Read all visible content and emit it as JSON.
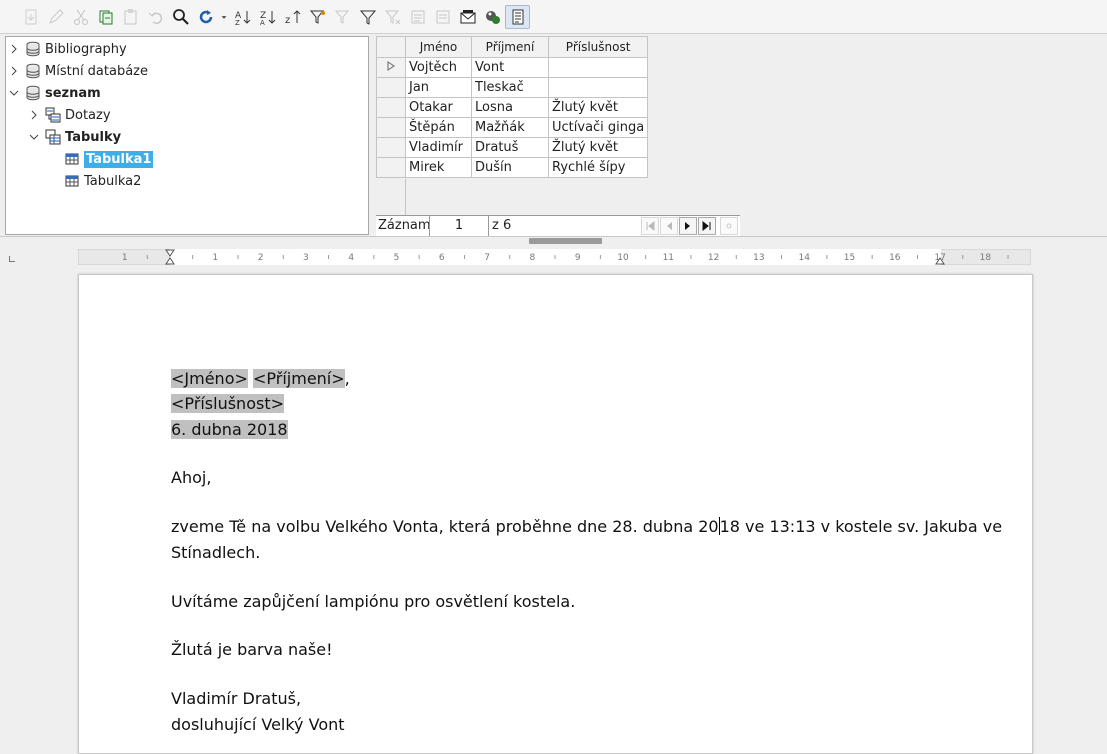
{
  "toolbar": {
    "buttons": [
      "save-record-icon",
      "edit-icon",
      "cut-icon",
      "copy-icon",
      "paste-icon",
      "undo-icon",
      "search-icon",
      "refresh-icon",
      "sort-ascending-icon",
      "sort-descending-icon",
      "sort-icon",
      "autofilter-icon",
      "standard-filter-icon",
      "filter-icon",
      "remove-filter-icon",
      "data-to-text-icon",
      "data-to-fields-icon",
      "mail-merge-icon",
      "data-source-icon",
      "explorer-icon"
    ]
  },
  "tree": {
    "items": [
      {
        "label": "Bibliography",
        "level": 0,
        "expanded": false,
        "kind": "db"
      },
      {
        "label": "Místní databáze",
        "level": 0,
        "expanded": false,
        "kind": "db"
      },
      {
        "label": "seznam",
        "level": 0,
        "expanded": true,
        "kind": "db",
        "bold": true
      },
      {
        "label": "Dotazy",
        "level": 1,
        "expanded": false,
        "kind": "queries"
      },
      {
        "label": "Tabulky",
        "level": 1,
        "expanded": true,
        "kind": "tables",
        "bold": true
      },
      {
        "label": "Tabulka1",
        "level": 2,
        "kind": "table",
        "selected": true
      },
      {
        "label": "Tabulka2",
        "level": 2,
        "kind": "table"
      }
    ]
  },
  "grid": {
    "headers": [
      "Jméno",
      "Příjmení",
      "Příslušnost"
    ],
    "rows": [
      [
        "Vojtěch",
        "Vont",
        ""
      ],
      [
        "Jan",
        "Tleskač",
        ""
      ],
      [
        "Otakar",
        "Losna",
        "Žlutý květ"
      ],
      [
        "Štěpán",
        "Mažňák",
        "Uctívači ginga"
      ],
      [
        "Vladimír",
        "Dratuš",
        "Žlutý květ"
      ],
      [
        "Mirek",
        "Dušín",
        "Rychlé šípy"
      ]
    ],
    "navbar": {
      "label": "Záznam",
      "record": "1",
      "of_text": "z 6"
    }
  },
  "ruler": {
    "marks": [
      "1",
      "1",
      "2",
      "3",
      "4",
      "5",
      "6",
      "7",
      "8",
      "9",
      "10",
      "11",
      "12",
      "13",
      "14",
      "15",
      "16",
      "17",
      "18"
    ]
  },
  "document": {
    "field_first": "<Jméno>",
    "field_last": "<Příjmení>",
    "comma": ",",
    "field_affiliation": "<Příslušnost>",
    "date": "6. dubna 2018",
    "greeting": "Ahoj,",
    "body1_a": "zveme Tě na volbu Velkého Vonta, která proběhne dne 28. dubna 20",
    "body1_b": "18 ve 13:13 v kostele sv. Jakuba ve",
    "body1_c": "Stínadlech.",
    "body2": "Uvítáme zapůjčení lampiónu pro osvětlení kostela.",
    "body3": "Žlutá je barva naše!",
    "sign1": "Vladimír Dratuš,",
    "sign2": "dosluhující Velký Vont"
  }
}
